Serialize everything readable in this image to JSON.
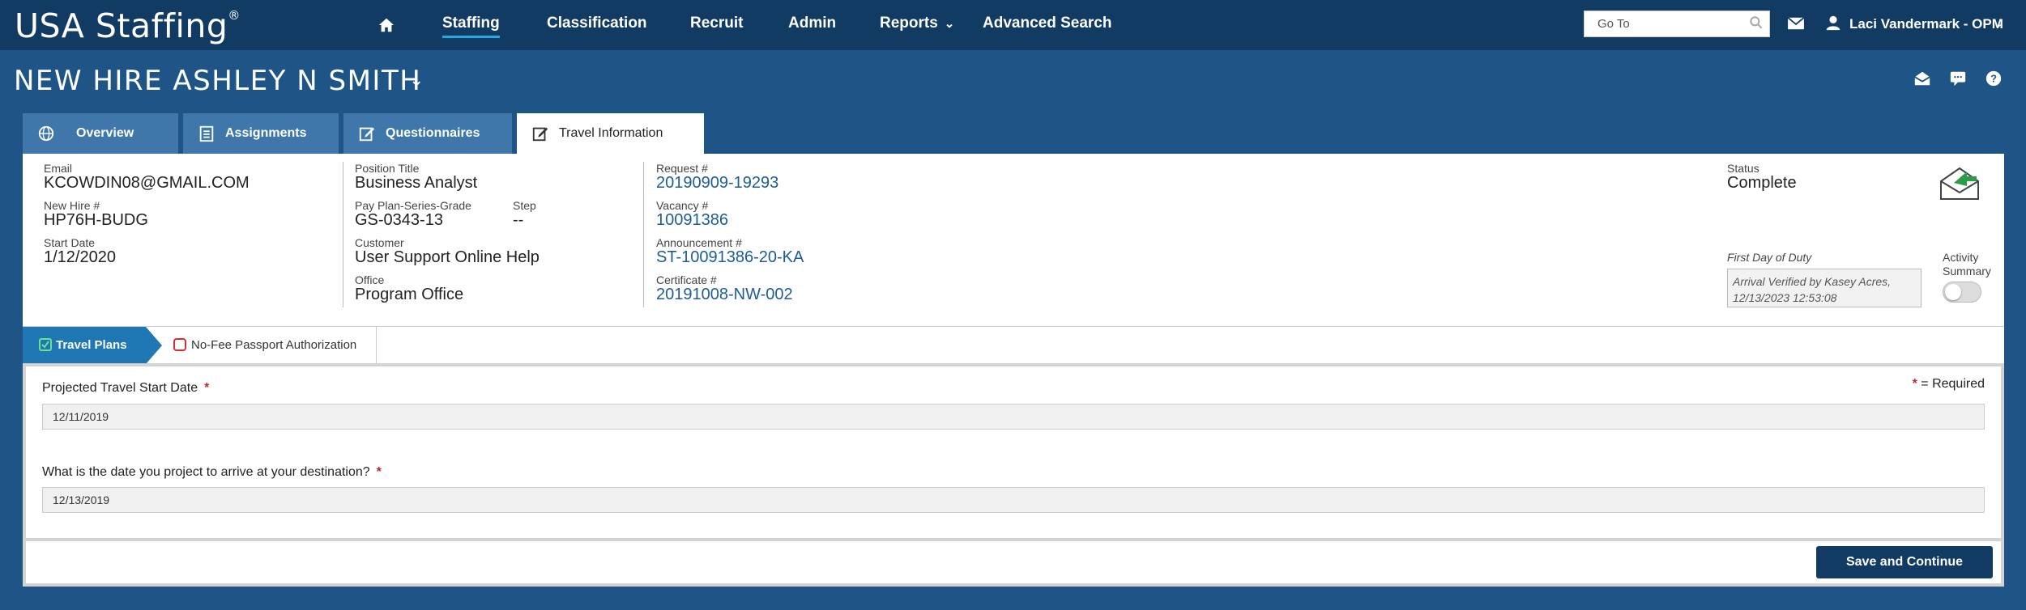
{
  "app": {
    "logo": "USA Staffing",
    "logo_mark": "®"
  },
  "nav": {
    "items": [
      "Staffing",
      "Classification",
      "Recruit",
      "Admin",
      "Reports",
      "Advanced Search"
    ],
    "goto_placeholder": "Go To",
    "user_name": "Laci Vandermark - OPM"
  },
  "header": {
    "title": "NEW HIRE ASHLEY N SMITH"
  },
  "tabs": [
    "Overview",
    "Assignments",
    "Questionnaires",
    "Travel Information"
  ],
  "info": {
    "email_label": "Email",
    "email": "KCOWDIN08@GMAIL.COM",
    "newhire_label": "New Hire #",
    "newhire": "HP76H-BUDG",
    "start_label": "Start Date",
    "start": "1/12/2020",
    "position_label": "Position Title",
    "position": "Business Analyst",
    "pay_label": "Pay Plan-Series-Grade",
    "pay": "GS-0343-13",
    "step_label": "Step",
    "step": "--",
    "customer_label": "Customer",
    "customer": "User Support Online Help",
    "office_label": "Office",
    "office": "Program Office",
    "request_label": "Request #",
    "request": "20190909-19293",
    "vacancy_label": "Vacancy #",
    "vacancy": "10091386",
    "announcement_label": "Announcement #",
    "announcement": "ST-10091386-20-KA",
    "certificate_label": "Certificate #",
    "certificate": "20191008-NW-002",
    "status_label": "Status",
    "status": "Complete",
    "duty_label": "First Day of Duty",
    "duty": "Arrival Verified by Kasey Acres, 12/13/2023 12:53:08",
    "activity_label_1": "Activity",
    "activity_label_2": "Summary"
  },
  "steps": {
    "active": "Travel Plans",
    "next": "No-Fee Passport Authorization"
  },
  "form": {
    "required_note": "= Required",
    "q1_label": "Projected Travel Start Date",
    "q1_value": "12/11/2019",
    "q2_label": "What is the date you project to arrive at your destination?",
    "q2_value": "12/13/2019",
    "req_mark": "*"
  },
  "footer": {
    "save_label": "Save and Continue"
  },
  "colors": {
    "topbar": "#123b63",
    "page": "#1f5487",
    "tab": "#3f77ab",
    "link": "#1d5c99",
    "step": "#1f77b4",
    "required": "#c1272d"
  }
}
